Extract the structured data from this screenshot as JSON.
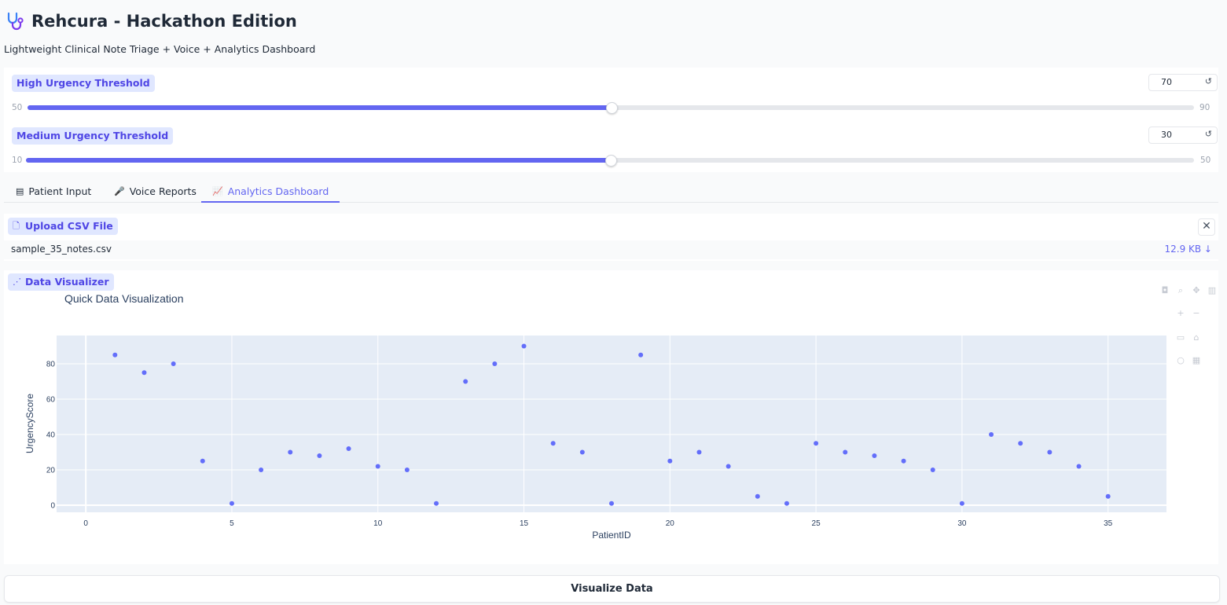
{
  "app": {
    "icon": "stethoscope-icon",
    "title": "Rehcura - Hackathon Edition",
    "subtitle": "Lightweight Clinical Note Triage + Voice + Analytics Dashboard"
  },
  "sliders": [
    {
      "label": "High Urgency Threshold",
      "value": "70",
      "min": "50",
      "max": "90",
      "fraction": 0.5,
      "reset_icon": "reset-icon"
    },
    {
      "label": "Medium Urgency Threshold",
      "value": "30",
      "min": "10",
      "max": "50",
      "fraction": 0.5,
      "reset_icon": "reset-icon"
    }
  ],
  "tabs": [
    {
      "icon": "memo-icon",
      "label": "Patient Input",
      "active": false
    },
    {
      "icon": "microphone-icon",
      "label": "Voice Reports",
      "active": false
    },
    {
      "icon": "chart-increasing-icon",
      "label": "Analytics Dashboard",
      "active": true
    }
  ],
  "upload": {
    "label": "Upload CSV File",
    "icon": "file-icon",
    "file_name": "sample_35_notes.csv",
    "file_size": "12.9 KB ↓",
    "close_icon": "close-icon"
  },
  "visualizer": {
    "label": "Data Visualizer",
    "icon": "scatter-chart-icon"
  },
  "chart_data": {
    "type": "scatter",
    "title": "Quick Data Visualization",
    "xlabel": "PatientID",
    "ylabel": "UrgencyScore",
    "xlim": [
      -1,
      37
    ],
    "ylim": [
      -4,
      96
    ],
    "xticks": [
      0,
      5,
      10,
      15,
      20,
      25,
      30,
      35
    ],
    "yticks": [
      0,
      20,
      40,
      60,
      80
    ],
    "grid": true,
    "marker_color": "#636efa",
    "plot_bg": "#e5ecf6",
    "x": [
      1,
      2,
      3,
      4,
      5,
      6,
      7,
      8,
      9,
      10,
      11,
      12,
      13,
      14,
      15,
      16,
      17,
      18,
      19,
      20,
      21,
      22,
      23,
      24,
      25,
      26,
      27,
      28,
      29,
      30,
      31,
      32,
      33,
      34,
      35
    ],
    "y": [
      85,
      75,
      80,
      25,
      1,
      20,
      30,
      28,
      32,
      22,
      20,
      1,
      70,
      80,
      90,
      35,
      30,
      1,
      85,
      25,
      30,
      22,
      5,
      1,
      35,
      30,
      28,
      25,
      20,
      1,
      40,
      35,
      30,
      22,
      5
    ]
  },
  "actions": {
    "visualize_label": "Visualize Data"
  },
  "colors": {
    "accent": "#6366f1",
    "pill_bg": "#e0e7ff"
  }
}
